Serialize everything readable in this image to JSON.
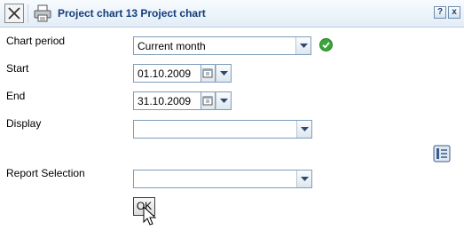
{
  "window": {
    "title": "Project chart 13 Project chart",
    "help_label": "?",
    "close_label": "x"
  },
  "form": {
    "chart_period": {
      "label": "Chart period",
      "value": "Current month"
    },
    "start": {
      "label": "Start",
      "value": "01.10.2009"
    },
    "end": {
      "label": "End",
      "value": "31.10.2009"
    },
    "display": {
      "label": "Display",
      "value": ""
    },
    "report_selection": {
      "label": "Report Selection",
      "value": ""
    },
    "ok_label": "OK"
  },
  "icons": {
    "close": "close-icon",
    "print": "print-icon",
    "check": "check-icon",
    "calendar": "calendar-icon",
    "list": "list-icon",
    "cursor": "mouse-cursor-icon"
  },
  "colors": {
    "title": "#123d7a",
    "check": "#3aa63a",
    "field_border": "#7f9db9"
  }
}
